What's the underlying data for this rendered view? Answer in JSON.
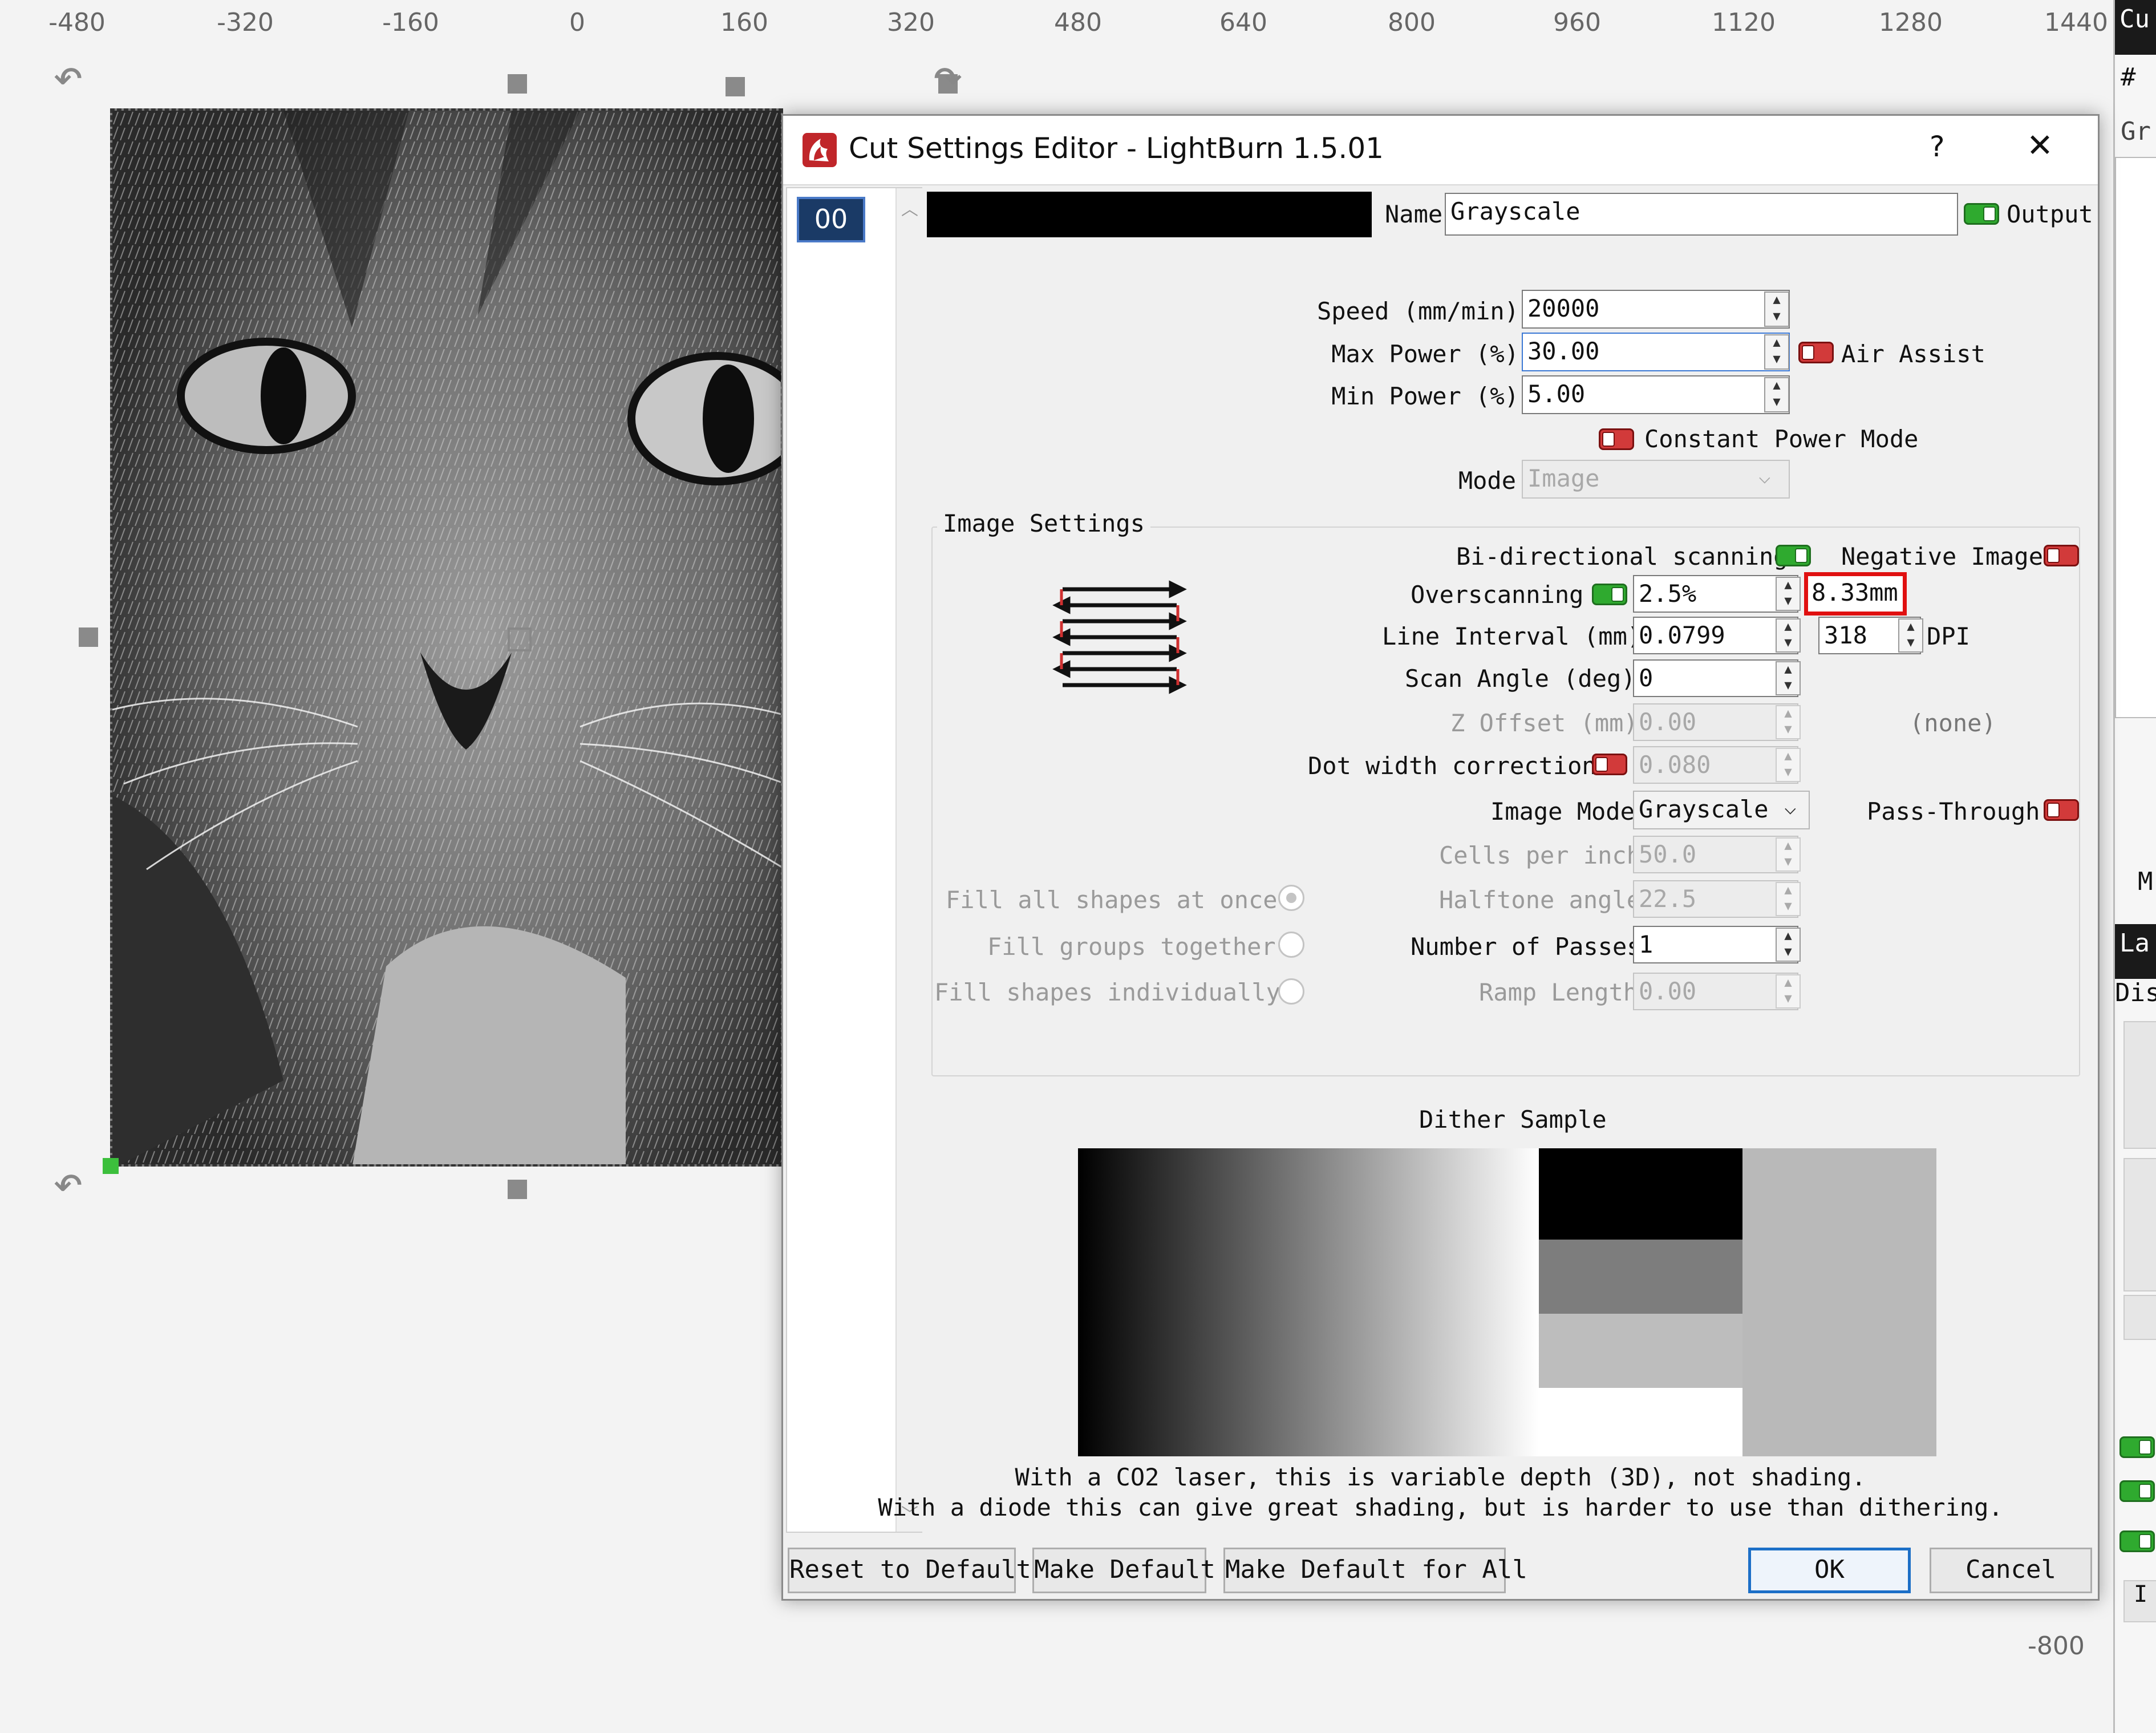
{
  "ruler": {
    "ticks": [
      "-480",
      "-320",
      "-160",
      "0",
      "160",
      "320",
      "480",
      "640",
      "800",
      "960",
      "1120",
      "1280",
      "1440"
    ]
  },
  "canvas": {
    "bottom_value": "-800"
  },
  "right_panel": {
    "labels": [
      "Cu",
      "#",
      "Gr",
      "M",
      "La",
      "Dis",
      "I"
    ]
  },
  "dialog": {
    "title": "Cut Settings Editor - LightBurn 1.5.01",
    "help": "?",
    "close": "✕",
    "layer_list": {
      "selected": "00"
    },
    "color_swatch": "#000000",
    "name_label": "Name",
    "name_value": "Grayscale",
    "output_label": "Output",
    "speed_label": "Speed (mm/min)",
    "speed_value": "20000",
    "max_power_label": "Max Power (%)",
    "max_power_value": "30.00",
    "air_assist_label": "Air Assist",
    "min_power_label": "Min Power (%)",
    "min_power_value": "5.00",
    "constant_power_label": "Constant Power Mode",
    "mode_label": "Mode",
    "mode_value": "Image",
    "image_settings_title": "Image Settings",
    "bidir_label": "Bi-directional scanning",
    "negative_label": "Negative Image",
    "overscan_label": "Overscanning",
    "overscan_value": "2.5%",
    "overscan_mm": "8.33mm",
    "line_interval_label": "Line Interval (mm)",
    "line_interval_value": "0.0799",
    "dpi_value": "318",
    "dpi_label": "DPI",
    "scan_angle_label": "Scan Angle (deg)",
    "scan_angle_value": "0",
    "z_offset_label": "Z Offset (mm)",
    "z_offset_value": "0.00",
    "none_label": "(none)",
    "dot_width_label": "Dot width correction",
    "dot_width_value": "0.080",
    "image_mode_label": "Image Mode",
    "image_mode_value": "Grayscale",
    "pass_through_label": "Pass-Through",
    "cells_label": "Cells per inch",
    "cells_value": "50.0",
    "halftone_label": "Halftone angle",
    "halftone_value": "22.5",
    "passes_label": "Number of Passes",
    "passes_value": "1",
    "ramp_label": "Ramp Length",
    "ramp_value": "0.00",
    "fill_all_label": "Fill all shapes at once",
    "fill_groups_label": "Fill groups together",
    "fill_individually_label": "Fill shapes individually",
    "dither_title": "Dither Sample",
    "note_line1": "With a CO2 laser, this is variable depth (3D), not shading.",
    "note_line2": "With a diode this can give great shading, but is harder to use than dithering.",
    "reset_button": "Reset to Default",
    "make_default_button": "Make Default",
    "make_default_all_button": "Make Default for All",
    "ok_button": "OK",
    "cancel_button": "Cancel",
    "highlight_color": "#e01010",
    "toggle_on_color": "#2faa2f",
    "toggle_off_color": "#d23a3a"
  }
}
